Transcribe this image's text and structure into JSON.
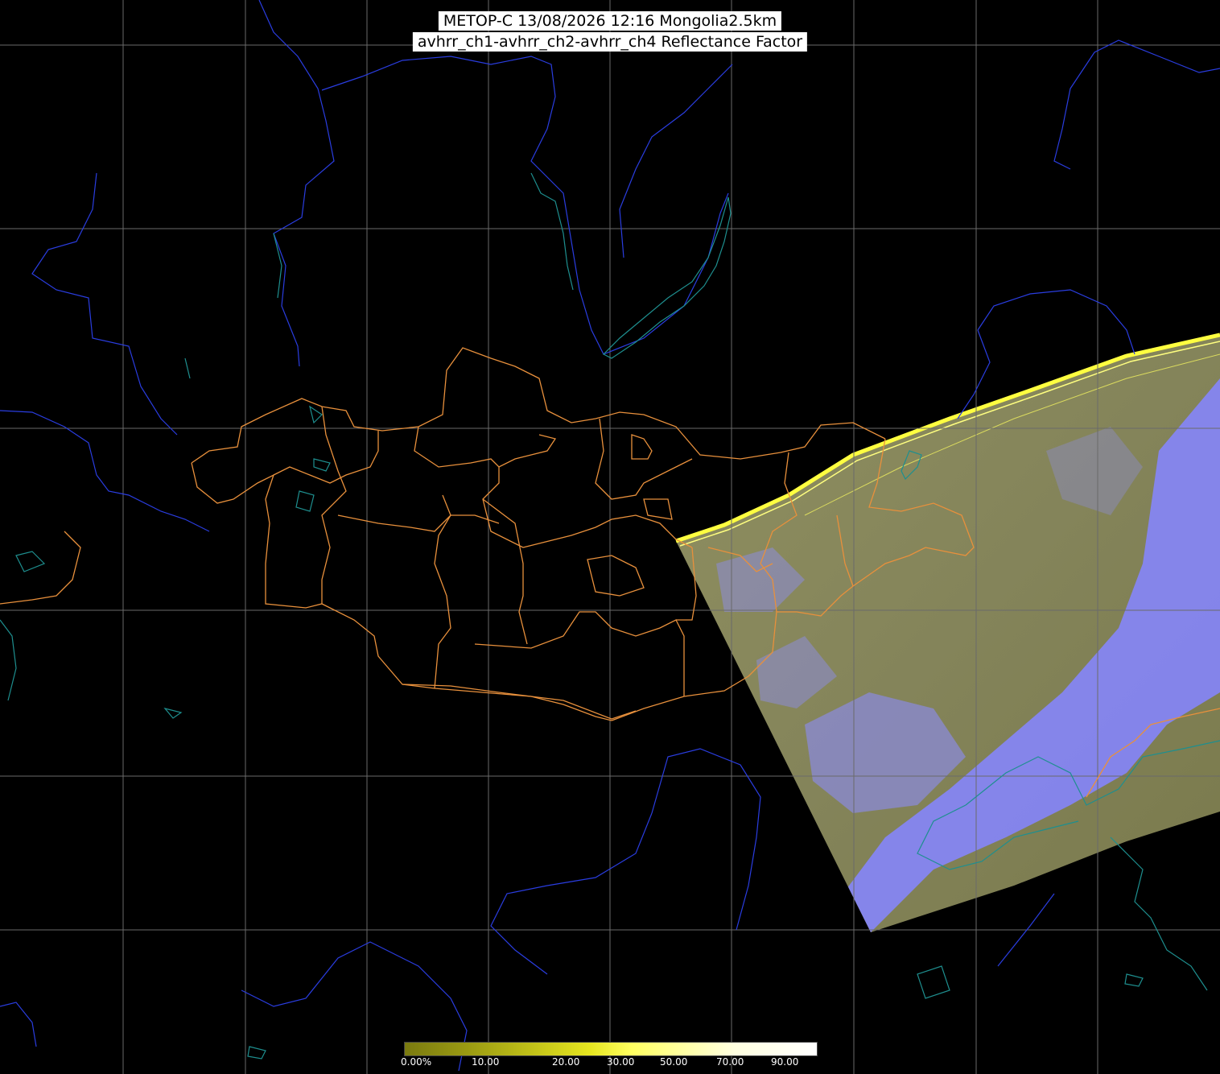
{
  "header": {
    "title_line1": "METOP-C 13/08/2026 12:16 Mongolia2.5km",
    "title_line2": "avhrr_ch1-avhrr_ch2-avhrr_ch4 Reflectance Factor"
  },
  "colorbar": {
    "labels": [
      "0.00%",
      "10.00",
      "20.00",
      "30.00",
      "50.00",
      "70.00",
      "90.00"
    ]
  },
  "colors": {
    "background": "#000000",
    "graticule": "#6a6a6a",
    "rivers": "#2a3de0",
    "lakes_coast": "#1e8f8f",
    "admin_borders": "#e8903c",
    "swath_land": "#8a8a55",
    "swath_cloud": "#8080f0",
    "swath_edge": "#ffff40"
  }
}
